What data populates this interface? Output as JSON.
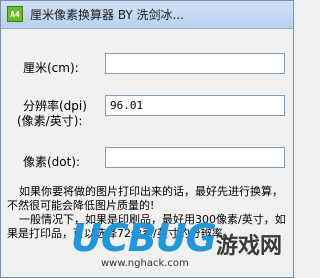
{
  "window": {
    "title": "厘米像素换算器 BY 洗剑冰...",
    "icon_text": "A4"
  },
  "form": {
    "cm_label": "厘米(cm):",
    "cm_value": "",
    "dpi_label_line1": "分辨率(dpi)",
    "dpi_label_line2": "(像素/英寸):",
    "dpi_value": "96.01",
    "pixels_label": "像素(dot):",
    "pixels_value": ""
  },
  "info": {
    "paragraph1": "如果你要将做的图片打印出来的话，最好先进行换算，不然很可能会降低图片质量的!",
    "paragraph2": "一般情况下，如果是印刷品，最好用300像素/英寸，如果是打印品，可以选择72像素/英寸的分辨率。"
  },
  "watermark": {
    "logo": "UCBUG",
    "site": "游戏网",
    "url": "www.nghack.com"
  }
}
